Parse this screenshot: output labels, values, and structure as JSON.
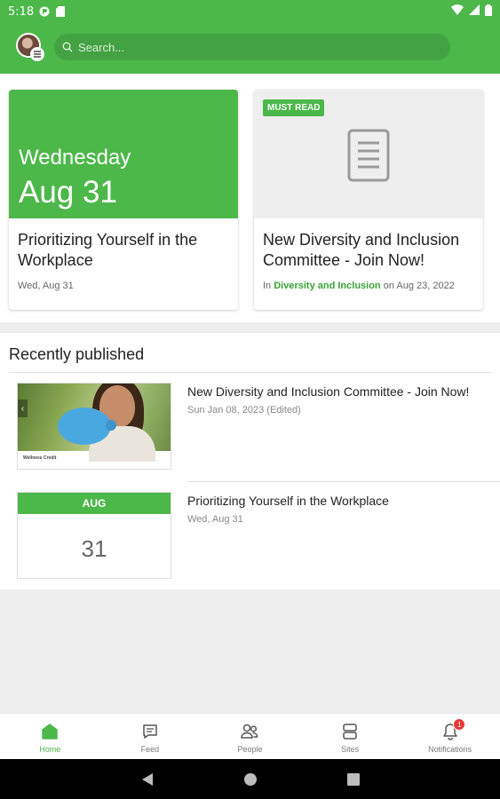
{
  "status_bar": {
    "time": "5:18"
  },
  "search": {
    "placeholder": "Search..."
  },
  "featured": [
    {
      "hero_day": "Wednesday",
      "hero_date": "Aug 31",
      "title": "Prioritizing Yourself in the Workplace",
      "meta": "Wed, Aug 31"
    },
    {
      "badge": "MUST READ",
      "title": "New Diversity and Inclusion Committee - Join Now!",
      "meta_prefix": "In ",
      "meta_link": "Diversity and Inclusion",
      "meta_suffix": " on Aug 23, 2022"
    }
  ],
  "recent": {
    "heading": "Recently published",
    "items": [
      {
        "title": "New Diversity and Inclusion Committee - Join Now!",
        "meta": "Sun Jan 08, 2023 (Edited)",
        "thumb_caption": "Wellness Credit"
      },
      {
        "title": "Prioritizing Yourself in the Workplace",
        "meta": "Wed, Aug 31",
        "cal_month": "AUG",
        "cal_day": "31"
      }
    ]
  },
  "bottom_nav": [
    {
      "label": "Home",
      "icon": "home-icon",
      "active": true
    },
    {
      "label": "Feed",
      "icon": "feed-icon"
    },
    {
      "label": "People",
      "icon": "people-icon"
    },
    {
      "label": "Sites",
      "icon": "sites-icon"
    },
    {
      "label": "Notifications",
      "icon": "bell-icon",
      "badge": "1"
    }
  ],
  "colors": {
    "brand": "#4cb84a",
    "link": "#3aa338",
    "badge": "#e53935"
  }
}
